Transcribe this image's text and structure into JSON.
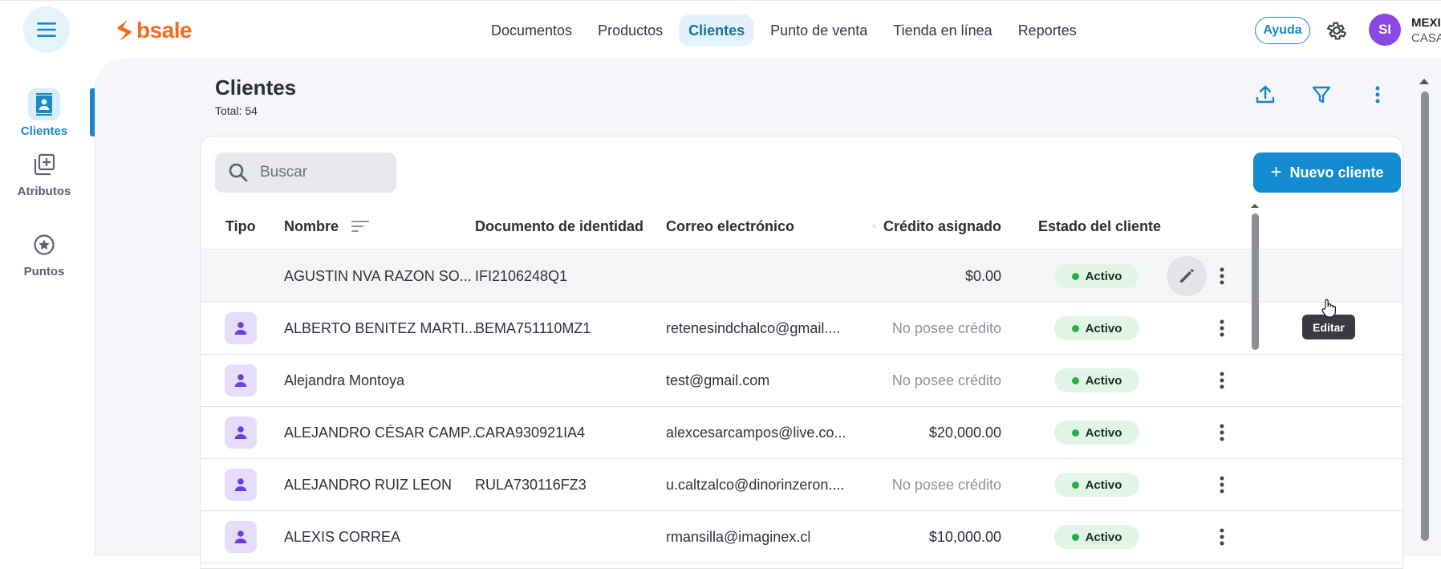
{
  "topbar": {
    "brand": "bsale",
    "nav": [
      "Documentos",
      "Productos",
      "Clientes",
      "Punto de venta",
      "Tienda en línea",
      "Reportes"
    ],
    "active_nav": "Clientes",
    "help_label": "Ayuda",
    "avatar_initials": "SI",
    "company_name": "MEXI",
    "company_branch": "CASA"
  },
  "rail": {
    "items": [
      {
        "label": "Clientes",
        "icon": "contacts-icon",
        "active": true
      },
      {
        "label": "Atributos",
        "icon": "add-library-icon",
        "active": false
      },
      {
        "label": "Puntos",
        "icon": "star-circle-icon",
        "active": false
      }
    ]
  },
  "page": {
    "title": "Clientes",
    "total": "Total: 54"
  },
  "toolbar": {
    "search_placeholder": "Buscar",
    "new_button_label": "Nuevo cliente",
    "new_button_icon": "+"
  },
  "table": {
    "columns": [
      "Tipo",
      "Nombre",
      "Documento de identidad",
      "Correo electrónico",
      "Crédito asignado",
      "Estado del cliente"
    ],
    "rows": [
      {
        "type": "company",
        "name": "AGUSTIN NVA RAZON SO...",
        "doc": "IFI2106248Q1",
        "email": "",
        "credit": "$0.00",
        "credit_muted": false,
        "status": "Activo"
      },
      {
        "type": "person",
        "name": "ALBERTO BENITEZ MARTI...",
        "doc": "BEMA751110MZ1",
        "email": "retenesindchalco@gmail....",
        "credit": "No posee crédito",
        "credit_muted": true,
        "status": "Activo"
      },
      {
        "type": "person",
        "name": "Alejandra Montoya",
        "doc": "",
        "email": "test@gmail.com",
        "credit": "No posee crédito",
        "credit_muted": true,
        "status": "Activo"
      },
      {
        "type": "person",
        "name": "ALEJANDRO CÉSAR CAMP...",
        "doc": "CARA930921IA4",
        "email": "alexcesarcampos@live.co...",
        "credit": "$20,000.00",
        "credit_muted": false,
        "status": "Activo"
      },
      {
        "type": "person",
        "name": "ALEJANDRO RUIZ LEON",
        "doc": "RULA730116FZ3",
        "email": "u.caltzalco@dinorinzeron....",
        "credit": "No posee crédito",
        "credit_muted": true,
        "status": "Activo"
      },
      {
        "type": "person",
        "name": "ALEXIS CORREA",
        "doc": "",
        "email": "rmansilla@imaginex.cl",
        "credit": "$10,000.00",
        "credit_muted": false,
        "status": "Activo"
      }
    ]
  },
  "tooltip": "Editar",
  "colors": {
    "accent": "#148bd0",
    "brand": "#f26b21",
    "status_green": "#22b04b",
    "avatar": "#8b47e6"
  }
}
